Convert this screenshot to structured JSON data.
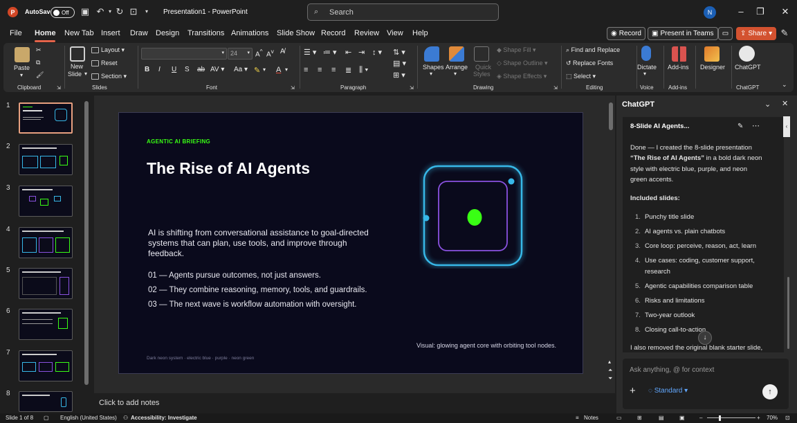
{
  "titlebar": {
    "logo": "P",
    "autosave_label": "AutoSave",
    "autosave_state": "Off",
    "document_title": "Presentation1 - PowerPoint",
    "search_placeholder": "Search",
    "avatar_initial": "N"
  },
  "tabs": [
    "File",
    "Home",
    "New Tab",
    "Insert",
    "Draw",
    "Design",
    "Transitions",
    "Animations",
    "Slide Show",
    "Record",
    "Review",
    "View",
    "Help"
  ],
  "active_tab": "Home",
  "tab_actions": {
    "record": "Record",
    "present": "Present in Teams",
    "share": "Share"
  },
  "ribbon": {
    "clipboard": {
      "paste": "Paste",
      "group": "Clipboard"
    },
    "slides": {
      "new_slide_1": "New",
      "new_slide_2": "Slide",
      "layout": "Layout",
      "reset": "Reset",
      "section": "Section",
      "group": "Slides"
    },
    "font": {
      "size": "24",
      "group": "Font"
    },
    "paragraph": {
      "group": "Paragraph"
    },
    "drawing": {
      "shapes": "Shapes",
      "arrange": "Arrange",
      "quick_styles_1": "Quick",
      "quick_styles_2": "Styles",
      "shape_fill": "Shape Fill",
      "shape_outline": "Shape Outline",
      "shape_effects": "Shape Effects",
      "group": "Drawing"
    },
    "editing": {
      "find_replace": "Find and Replace",
      "replace_fonts": "Replace Fonts",
      "select": "Select",
      "group": "Editing"
    },
    "voice": {
      "dictate": "Dictate",
      "group": "Voice"
    },
    "addins": {
      "label": "Add-ins",
      "group": "Add-ins"
    },
    "designer": {
      "label": "Designer"
    },
    "chatgpt": {
      "label": "ChatGPT",
      "group": "ChatGPT"
    }
  },
  "thumbnails": {
    "numbers": [
      "1",
      "2",
      "3",
      "4",
      "5",
      "6",
      "7",
      "8"
    ],
    "selected": "1"
  },
  "slide": {
    "kicker": "AGENTIC AI BRIEFING",
    "title": "The Rise of AI Agents",
    "body": "AI is shifting from conversational assistance to goal-directed systems that can plan, use tools, and improve through feedback.",
    "bullets": [
      "01 — Agents pursue outcomes, not just answers.",
      "02 — They combine reasoning, memory, tools, and guardrails.",
      "03 — The next wave is workflow automation with oversight."
    ],
    "visual_caption": "Visual: glowing agent core with orbiting tool nodes.",
    "footer": "Dark neon system · electric blue · purple · neon green",
    "colors": {
      "bg": "#0a0a1c",
      "blue": "#37b8e8",
      "purple": "#8a52e0",
      "green": "#39ff14"
    }
  },
  "notes_placeholder": "Click to add notes",
  "chat": {
    "pane_title": "ChatGPT",
    "conversation_title": "8-Slide AI Agents...",
    "msg_intro_1": "Done — I created the 8-slide presentation",
    "msg_intro_2_bold": "“The Rise of AI Agents”",
    "msg_intro_2_rest": " in a bold dark neon",
    "msg_intro_3": "style with electric blue, purple, and neon",
    "msg_intro_4": "green accents.",
    "included_heading": "Included slides:",
    "list": [
      {
        "n": "1.",
        "t": "Punchy title slide"
      },
      {
        "n": "2.",
        "t": "AI agents vs. plain chatbots"
      },
      {
        "n": "3.",
        "t": "Core loop: perceive, reason, act, learn"
      },
      {
        "n": "4.",
        "t": "Use cases: coding, customer support,"
      },
      {
        "n": "5.",
        "t": "Agentic capabilities comparison table"
      },
      {
        "n": "6.",
        "t": "Risks and limitations"
      },
      {
        "n": "7.",
        "t": "Two-year outlook"
      },
      {
        "n": "8.",
        "t": "Closing call-to-action"
      }
    ],
    "list_4_cont": "research",
    "msg_tail": "I also removed the original blank starter slide,",
    "input_placeholder": "Ask anything, @ for context",
    "mode": "Standard"
  },
  "status": {
    "slide_of": "Slide 1 of 8",
    "language": "English (United States)",
    "accessibility": "Accessibility: Investigate",
    "notes": "Notes",
    "zoom": "70%"
  }
}
